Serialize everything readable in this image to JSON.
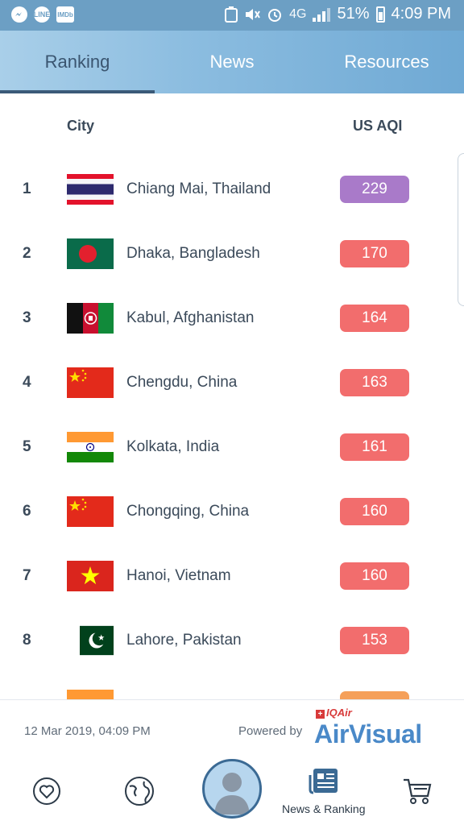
{
  "status_bar": {
    "time": "4:09 PM",
    "battery": "51%",
    "network": "4G",
    "left_icons": [
      "messenger-icon",
      "line-icon",
      "imdb-icon"
    ],
    "left_icon_labels": [
      "",
      "LINE",
      "IMDb"
    ]
  },
  "tabs": [
    {
      "label": "Ranking",
      "active": true
    },
    {
      "label": "News",
      "active": false
    },
    {
      "label": "Resources",
      "active": false
    }
  ],
  "table": {
    "city_header": "City",
    "aqi_header": "US AQI",
    "rows": [
      {
        "rank": "1",
        "city": "Chiang Mai, Thailand",
        "aqi": "229",
        "color": "#a97ac9",
        "flag": "thailand"
      },
      {
        "rank": "2",
        "city": "Dhaka, Bangladesh",
        "aqi": "170",
        "color": "#f26d6d",
        "flag": "bangladesh"
      },
      {
        "rank": "3",
        "city": "Kabul, Afghanistan",
        "aqi": "164",
        "color": "#f26d6d",
        "flag": "afghanistan"
      },
      {
        "rank": "4",
        "city": "Chengdu, China",
        "aqi": "163",
        "color": "#f26d6d",
        "flag": "china"
      },
      {
        "rank": "5",
        "city": "Kolkata, India",
        "aqi": "161",
        "color": "#f26d6d",
        "flag": "india"
      },
      {
        "rank": "6",
        "city": "Chongqing, China",
        "aqi": "160",
        "color": "#f26d6d",
        "flag": "china"
      },
      {
        "rank": "7",
        "city": "Hanoi, Vietnam",
        "aqi": "160",
        "color": "#f26d6d",
        "flag": "vietnam"
      },
      {
        "rank": "8",
        "city": "Lahore, Pakistan",
        "aqi": "153",
        "color": "#f26d6d",
        "flag": "pakistan"
      }
    ],
    "partial_row_color": "#f5a05a"
  },
  "footer": {
    "timestamp": "12 Mar 2019, 04:09 PM",
    "powered_by": "Powered by",
    "iqair": "IQAir",
    "brand": "AirVisual"
  },
  "bottom_nav": {
    "items": [
      "favorites-heart-icon",
      "globe-icon",
      "profile-avatar",
      "news-icon",
      "shop-cart-icon"
    ],
    "active_label": "News & Ranking"
  },
  "colors": {
    "tab_active": "#3a5570",
    "status_bar": "#6c9fc4",
    "brand": "#4a89c8"
  }
}
